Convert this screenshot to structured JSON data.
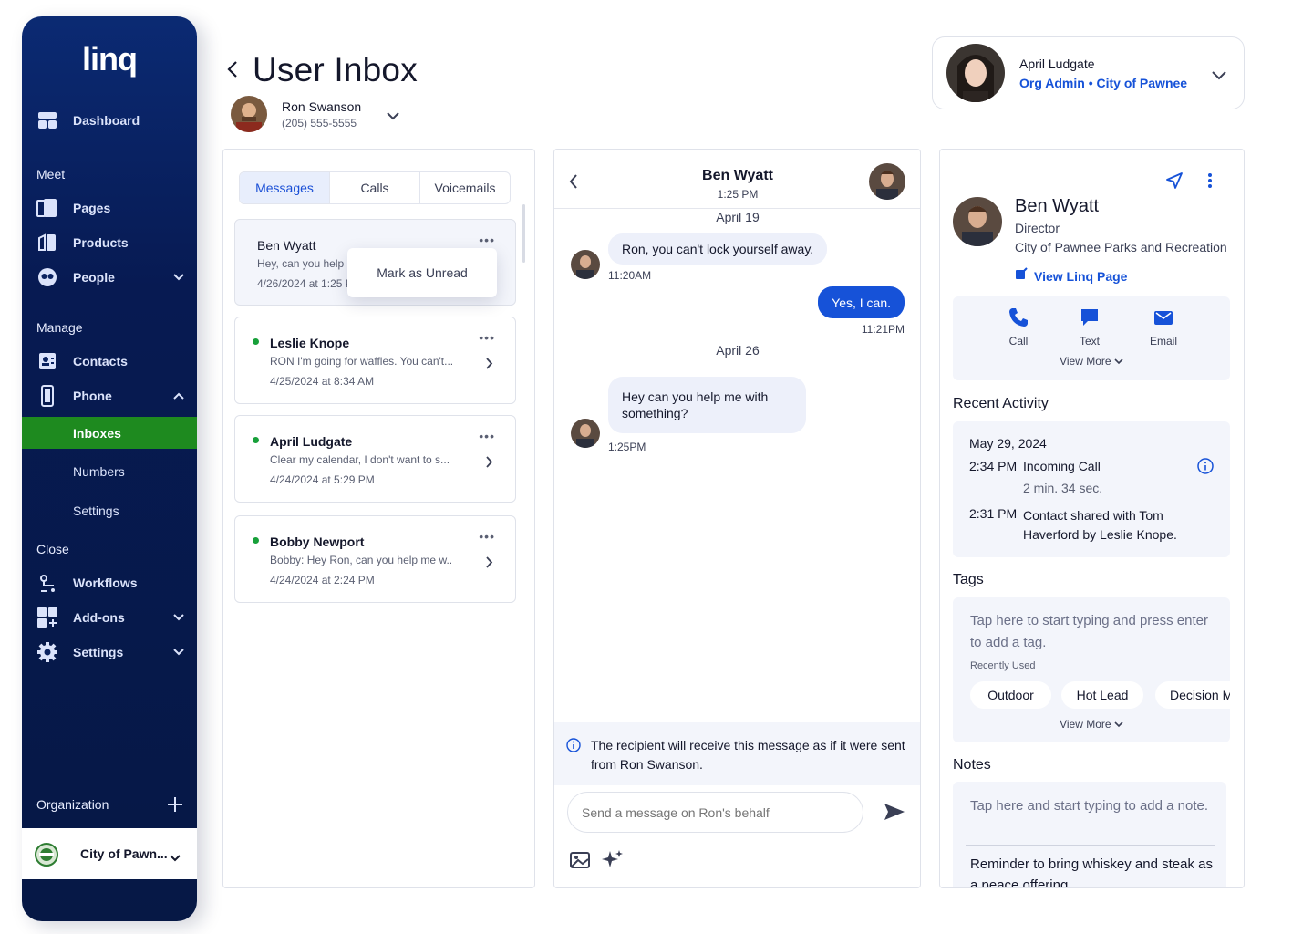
{
  "app": {
    "logo": "linq"
  },
  "sidebar": {
    "dashboard": "Dashboard",
    "section_meet": "Meet",
    "pages": "Pages",
    "products": "Products",
    "people": "People",
    "section_manage": "Manage",
    "contacts": "Contacts",
    "phone": "Phone",
    "inboxes": "Inboxes",
    "numbers": "Numbers",
    "settings_sub": "Settings",
    "section_close": "Close",
    "workflows": "Workflows",
    "addons": "Add-ons",
    "settings": "Settings",
    "organization": "Organization",
    "org_name": "City of Pawn...",
    "accent": "#1e8a1f"
  },
  "header": {
    "title": "User Inbox",
    "user_name": "Ron Swanson",
    "user_phone": "(205) 555-5555"
  },
  "profile": {
    "name": "April Ludgate",
    "role": "Org Admin • City of Pawnee",
    "role_color": "#1652d8"
  },
  "inbox": {
    "tabs": [
      "Messages",
      "Calls",
      "Voicemails"
    ],
    "threads": [
      {
        "name": "Ben Wyatt",
        "snippet": "Hey, can you help me with something?",
        "date": "4/26/2024 at 1:25 PM",
        "unread": false
      },
      {
        "name": "Leslie Knope",
        "snippet": "RON I'm going for waffles. You can't...",
        "date": "4/25/2024 at 8:34 AM",
        "unread": true
      },
      {
        "name": "April Ludgate",
        "snippet": "Clear my calendar, I don't want to s...",
        "date": "4/24/2024 at 5:29 PM",
        "unread": true
      },
      {
        "name": "Bobby Newport",
        "snippet": "Bobby: Hey Ron, can you help me w...",
        "date": "4/24/2024 at 2:24 PM",
        "unread": true
      }
    ],
    "context_menu": "Mark as Unread",
    "more": "•••"
  },
  "chat": {
    "contact": "Ben Wyatt",
    "time": "1:25 PM",
    "day1": "April 19",
    "msg1": "Ron, you can't lock yourself away.",
    "msg1_time": "11:20AM",
    "msg2": "Yes, I can.",
    "msg2_time": "11:21PM",
    "day2": "April 26",
    "msg3": "Hey can you help me with something?",
    "msg3_time": "1:25PM",
    "notice": "The recipient will receive this message as if it were sent from Ron Swanson.",
    "input_placeholder": "Send a message on Ron's behalf"
  },
  "contact": {
    "name": "Ben Wyatt",
    "title": "Director",
    "org": "City of Pawnee Parks and Recreation",
    "view_page": "View Linq Page",
    "actions": {
      "call": "Call",
      "text": "Text",
      "email": "Email"
    },
    "view_more": "View More",
    "recent_activity": "Recent Activity",
    "activity_date": "May 29, 2024",
    "activity": [
      {
        "time": "2:34 PM",
        "text": "Incoming Call",
        "detail": "2 min. 34 sec."
      },
      {
        "time": "2:31 PM",
        "text": "Contact shared with Tom Haverford by Leslie Knope."
      }
    ],
    "tags_label": "Tags",
    "tags_placeholder": "Tap here to start typing and press enter to add a tag.",
    "recently_used": "Recently Used",
    "tags": [
      "Outdoor",
      "Hot Lead",
      "Decision M"
    ],
    "tags_view_more": "View More",
    "notes_label": "Notes",
    "notes_placeholder": "Tap here and start typing to add a note.",
    "note1": "Reminder to bring whiskey and steak as a peace offering"
  }
}
